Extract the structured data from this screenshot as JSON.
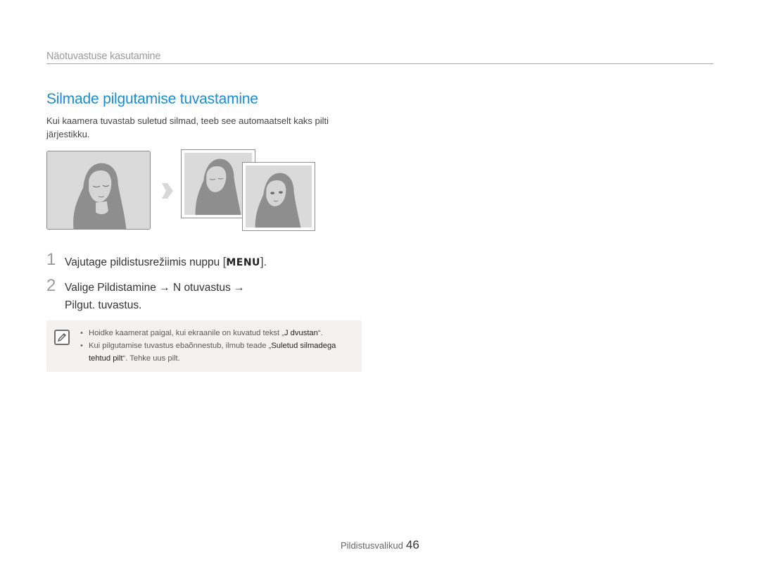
{
  "header": {
    "section_title": "Näotuvastuse kasutamine"
  },
  "main": {
    "title": "Silmade pilgutamise tuvastamine",
    "intro": "Kui kaamera tuvastab suletud silmad, teeb see automaatselt kaks pilti järjestikku.",
    "steps": [
      {
        "number": "1",
        "text_before": "Vajutage pildistusrežiimis nuppu ",
        "key_open": "[",
        "key": "MENU",
        "key_close": "]",
        "text_after": "."
      },
      {
        "number": "2",
        "text_before": "Valige ",
        "item1": "Pildistamine",
        "sep1": " → ",
        "item2": "N otuvastus",
        "sep2": " →",
        "item3": "Pilgut. tuvastus",
        "text_after": "."
      }
    ],
    "note": {
      "icon": "note-pencil-icon",
      "items": [
        {
          "before": "Hoidke kaamerat paigal, kui ekraanile on kuvatud tekst „",
          "highlight": "J dvustan",
          "after": "“."
        },
        {
          "before": "Kui pilgutamise tuvastus ebaõnnestub, ilmub teade „",
          "highlight": "Suletud silmadega tehtud pilt",
          "after": "“. Tehke uus pilt."
        }
      ]
    },
    "illustration": {
      "arrow_icon": "right-arrow-icon",
      "photo_color": "#d9d9d9",
      "figure_color": "#8a8a8a"
    }
  },
  "footer": {
    "section": "Pildistusvalikud",
    "page_number": "46"
  },
  "colors": {
    "accent": "#1a8ccf",
    "note_bg": "#f3f2f0"
  }
}
